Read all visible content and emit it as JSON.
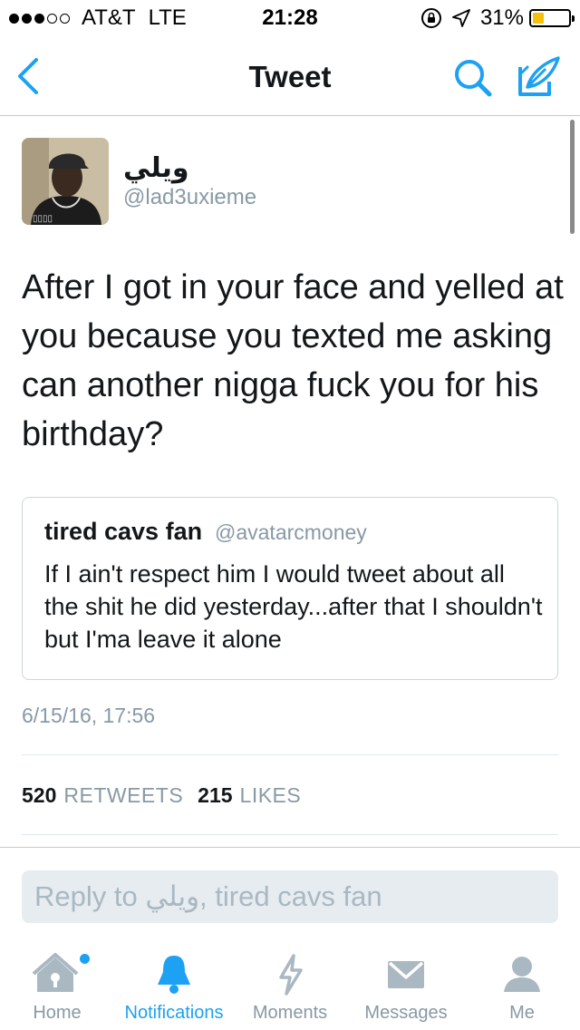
{
  "status_bar": {
    "carrier": "AT&T",
    "network": "LTE",
    "time": "21:28",
    "battery": "31%",
    "battery_level": 0.31,
    "battery_color": "#f4c20d"
  },
  "nav": {
    "title": "Tweet",
    "back_icon": "chevron-left-icon",
    "search_icon": "search-icon",
    "compose_icon": "compose-tweet-icon"
  },
  "tweet": {
    "display_name": "ويلي",
    "handle": "@lad3uxieme",
    "text": "After I got in your face and yelled at you because you texted me asking can another nigga fuck you for his birthday?",
    "quote": {
      "name": "tired cavs fan",
      "handle": "@avatarcmoney",
      "text": "If I ain't respect him I would tweet about all the shit he did yesterday...after that I shouldn't but I'ma leave it alone"
    },
    "timestamp": "6/15/16, 17:56",
    "stats": {
      "retweets_count": "520",
      "retweets_label": "RETWEETS",
      "likes_count": "215",
      "likes_label": "LIKES"
    }
  },
  "reply": {
    "placeholder": "Reply to ويلي, tired cavs fan"
  },
  "tabs": [
    {
      "label": "Home",
      "icon": "home-icon"
    },
    {
      "label": "Notifications",
      "icon": "bell-icon",
      "active": true
    },
    {
      "label": "Moments",
      "icon": "lightning-icon"
    },
    {
      "label": "Messages",
      "icon": "envelope-icon"
    },
    {
      "label": "Me",
      "icon": "person-icon"
    }
  ],
  "colors": {
    "accent": "#1da1f2",
    "muted": "#8899a6",
    "tab_icon": "#aab8c2"
  }
}
